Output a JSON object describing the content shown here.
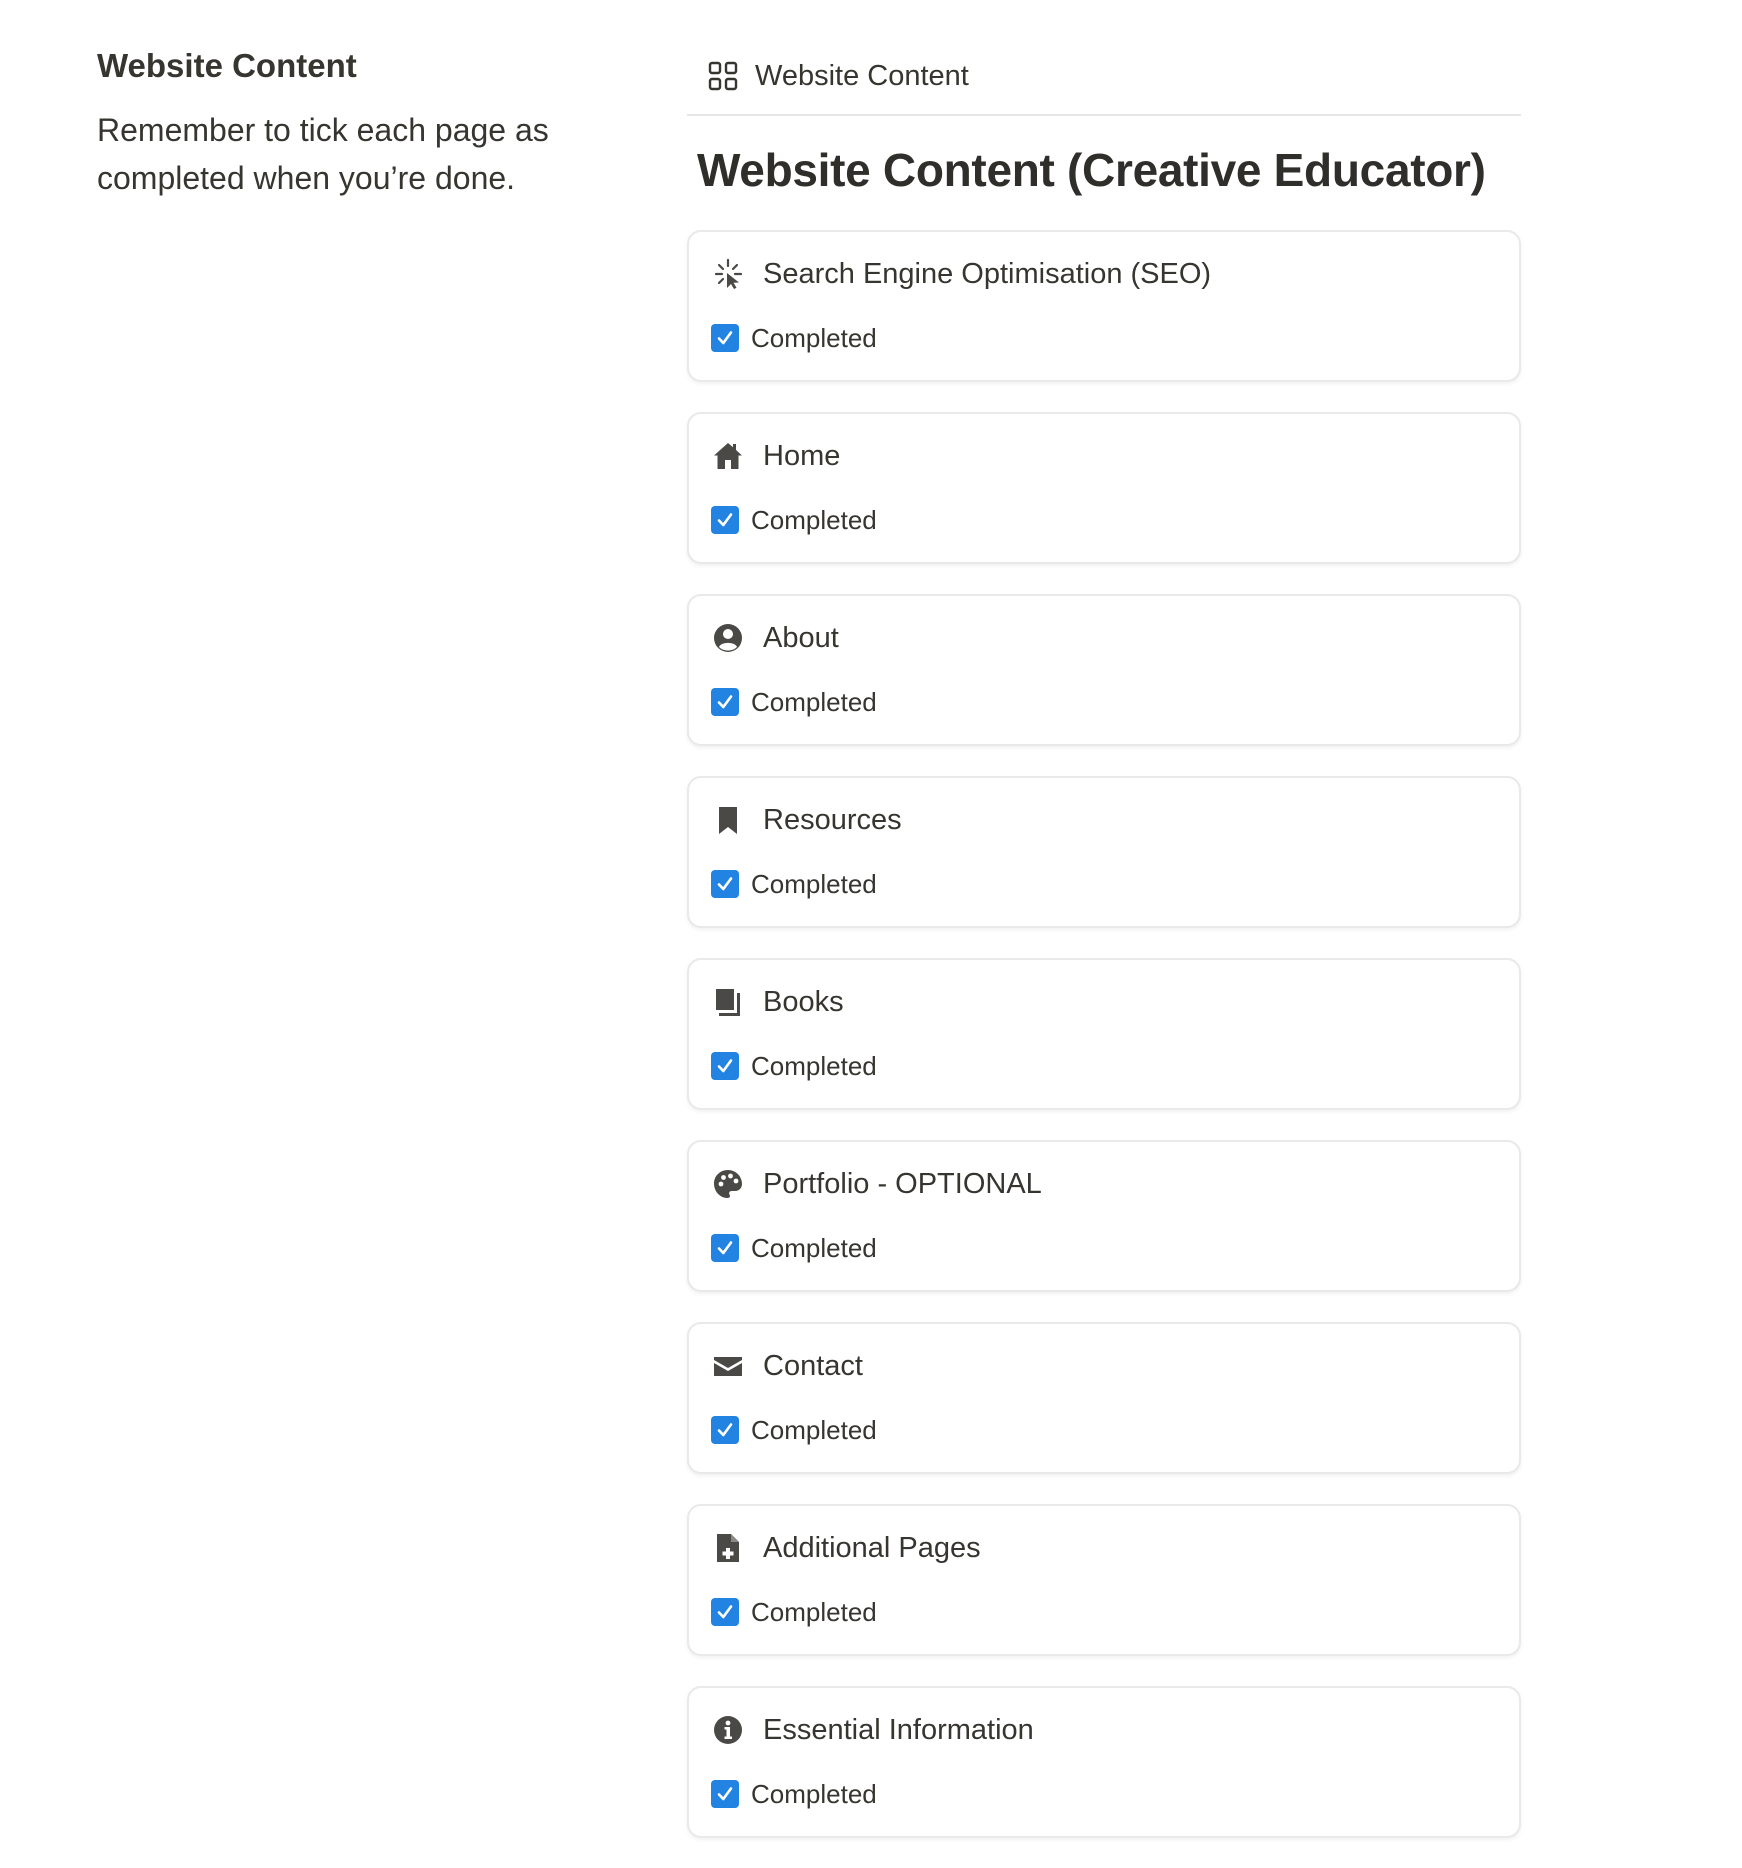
{
  "sidebar_note": {
    "title": "Website Content",
    "text": "Remember to tick each page as completed when you’re done."
  },
  "database": {
    "view_label": "Website Content",
    "title": "Website Content (Creative Educator)",
    "accent_color": "#2383e2",
    "items": [
      {
        "icon": "cursor-click-icon",
        "title": "Search Engine Optimisation (SEO)",
        "checked": true,
        "property_label": "Completed"
      },
      {
        "icon": "home-icon",
        "title": "Home",
        "checked": true,
        "property_label": "Completed"
      },
      {
        "icon": "user-circle-icon",
        "title": "About",
        "checked": true,
        "property_label": "Completed"
      },
      {
        "icon": "bookmark-icon",
        "title": "Resources",
        "checked": true,
        "property_label": "Completed"
      },
      {
        "icon": "books-icon",
        "title": "Books",
        "checked": true,
        "property_label": "Completed"
      },
      {
        "icon": "palette-icon",
        "title": "Portfolio - OPTIONAL",
        "checked": true,
        "property_label": "Completed"
      },
      {
        "icon": "envelope-icon",
        "title": "Contact",
        "checked": true,
        "property_label": "Completed"
      },
      {
        "icon": "file-plus-icon",
        "title": "Additional Pages",
        "checked": true,
        "property_label": "Completed"
      },
      {
        "icon": "info-circle-icon",
        "title": "Essential Information",
        "checked": true,
        "property_label": "Completed"
      }
    ]
  }
}
